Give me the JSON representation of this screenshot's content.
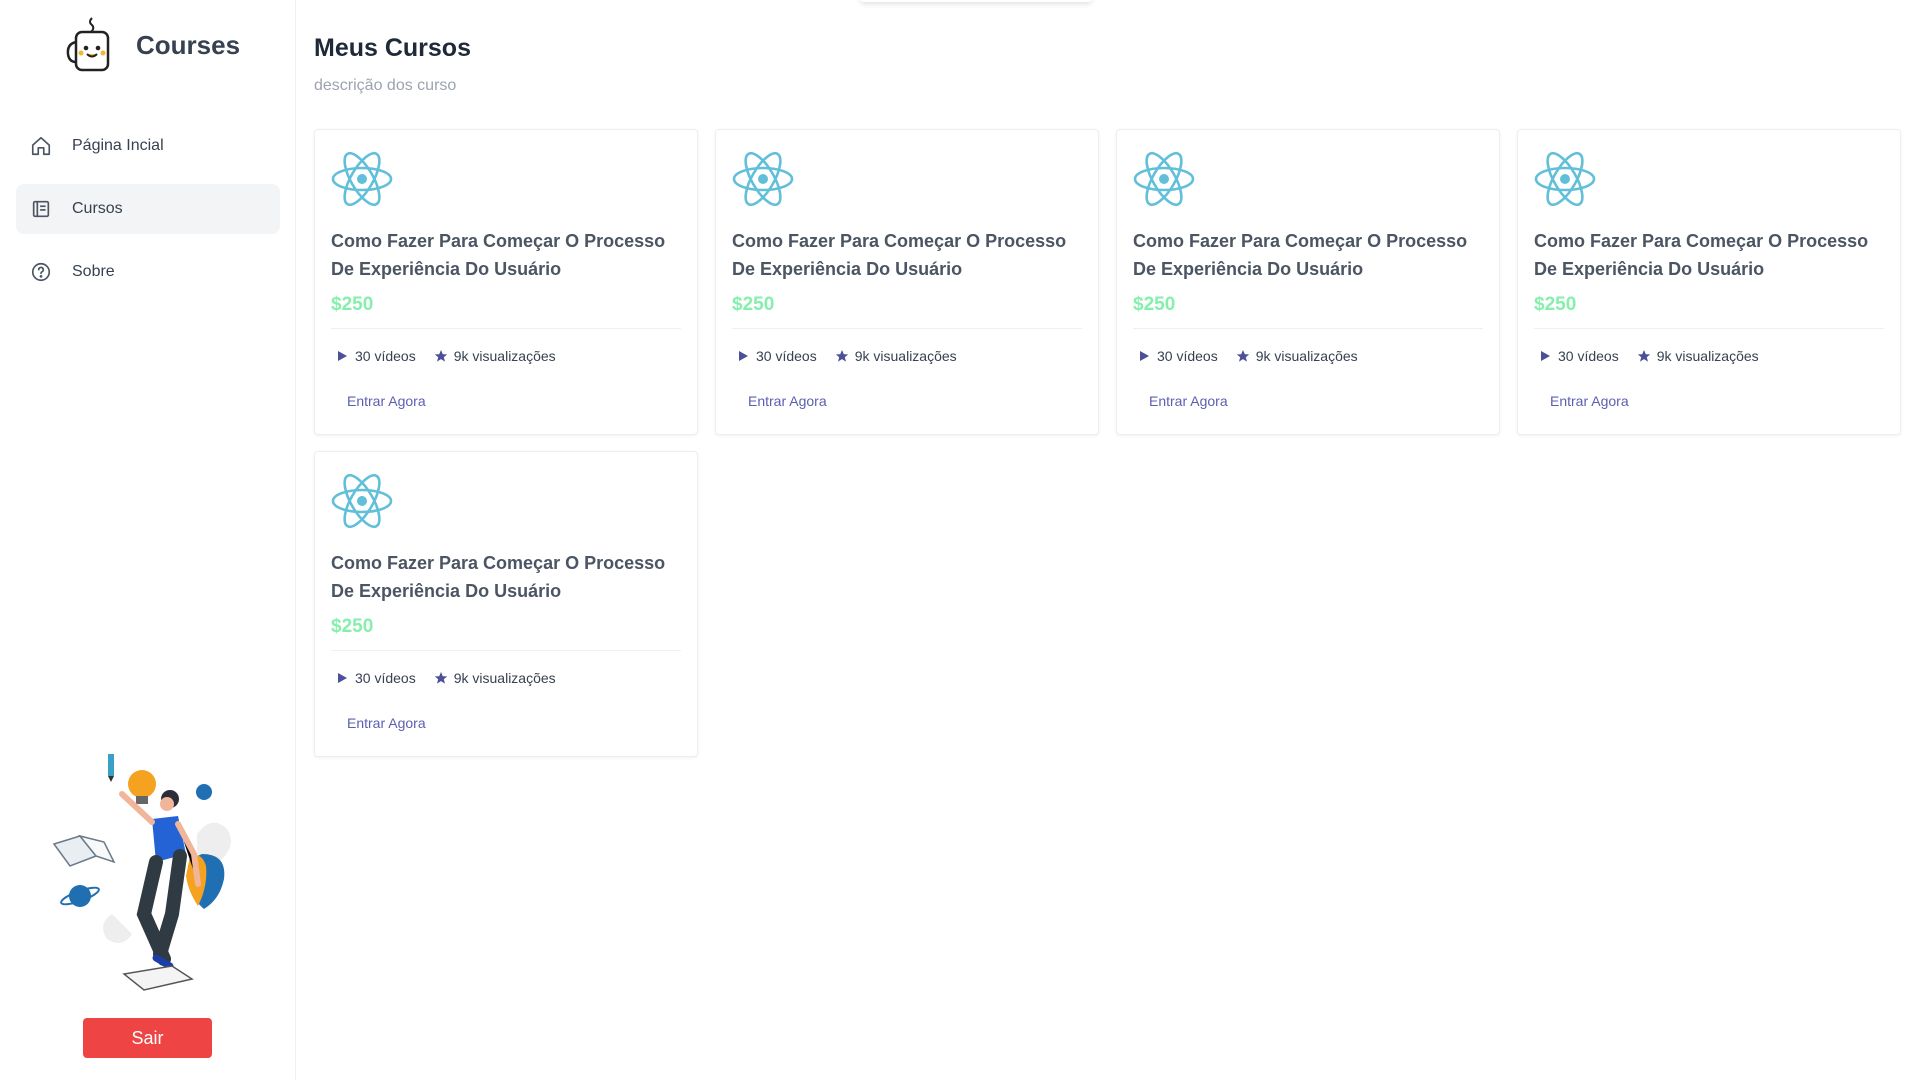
{
  "sidebar": {
    "brand": "Courses",
    "items": [
      {
        "label": "Página Incial",
        "icon": "home-icon"
      },
      {
        "label": "Cursos",
        "icon": "book-icon",
        "active": true
      },
      {
        "label": "Sobre",
        "icon": "help-circle-icon"
      }
    ],
    "logout_label": "Sair"
  },
  "main": {
    "title": "Meus Cursos",
    "description": "descrição dos curso",
    "courses": [
      {
        "title": "Como Fazer Para Começar O Processo De Experiência Do Usuário",
        "price": "$250",
        "videos": "30 vídeos",
        "views": "9k visualizações",
        "action": "Entrar Agora"
      },
      {
        "title": "Como Fazer Para Começar O Processo De Experiência Do Usuário",
        "price": "$250",
        "videos": "30 vídeos",
        "views": "9k visualizações",
        "action": "Entrar Agora"
      },
      {
        "title": "Como Fazer Para Começar O Processo De Experiência Do Usuário",
        "price": "$250",
        "videos": "30 vídeos",
        "views": "9k visualizações",
        "action": "Entrar Agora"
      },
      {
        "title": "Como Fazer Para Começar O Processo De Experiência Do Usuário",
        "price": "$250",
        "videos": "30 vídeos",
        "views": "9k visualizações",
        "action": "Entrar Agora"
      },
      {
        "title": "Como Fazer Para Começar O Processo De Experiência Do Usuário",
        "price": "$250",
        "videos": "30 vídeos",
        "views": "9k visualizações",
        "action": "Entrar Agora"
      }
    ]
  },
  "colors": {
    "accent": "#5b5fb0",
    "price": "#86efac",
    "logout": "#ef4444",
    "react": "#61bfd9"
  }
}
